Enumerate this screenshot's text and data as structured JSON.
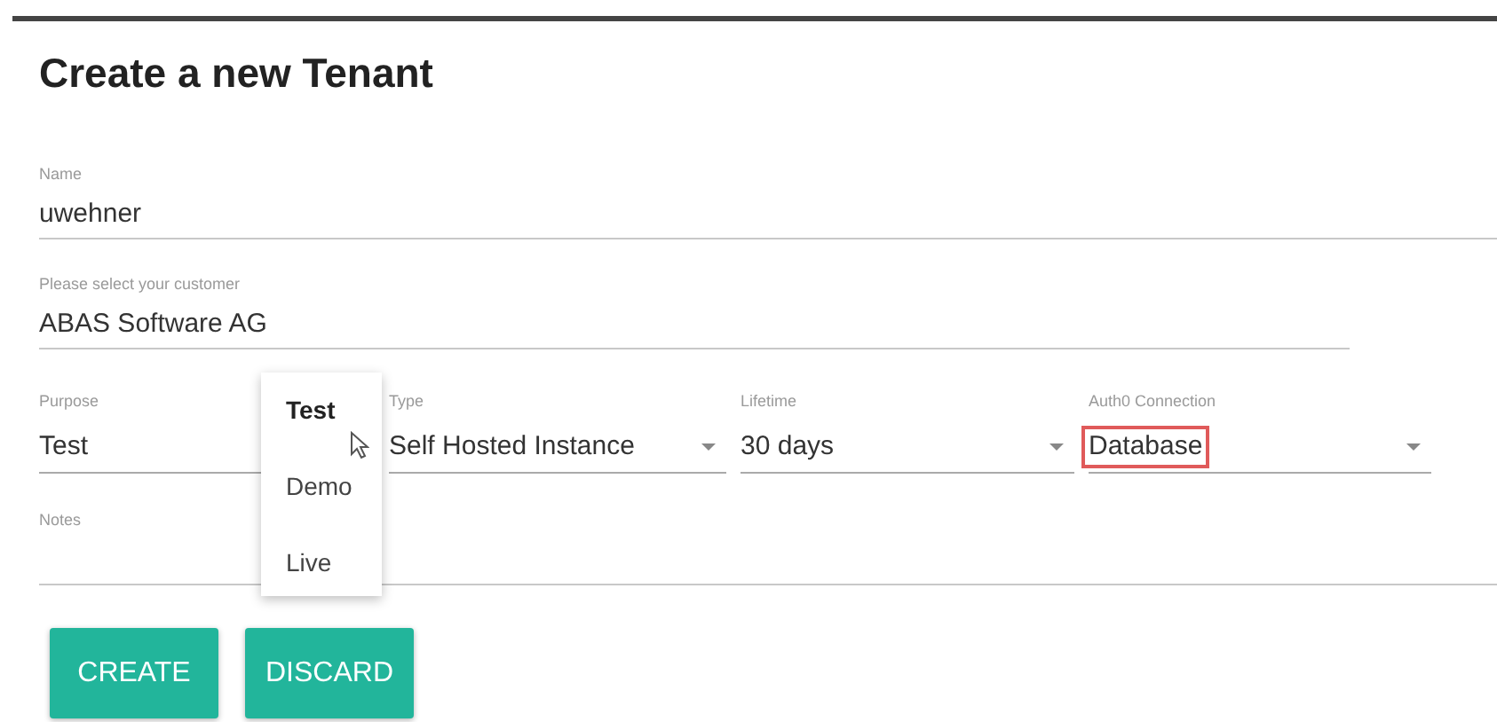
{
  "title": "Create a new Tenant",
  "fields": [
    {
      "label": "Name",
      "value": "uwehner"
    },
    {
      "label": "Please select your customer",
      "value": "ABAS Software AG"
    }
  ],
  "selects": [
    {
      "label": "Purpose",
      "value": "Test",
      "open": true,
      "highlighted": false
    },
    {
      "label": "Type",
      "value": "Self Hosted Instance",
      "open": false,
      "highlighted": false
    },
    {
      "label": "Lifetime",
      "value": "30 days",
      "open": false,
      "highlighted": false
    },
    {
      "label": "Auth0 Connection",
      "value": "Database",
      "open": false,
      "highlighted": true
    }
  ],
  "menu": [
    {
      "label": "Test",
      "selected": true
    },
    {
      "label": "Demo",
      "selected": false
    },
    {
      "label": "Live",
      "selected": false
    }
  ],
  "notes": {
    "label": "Notes"
  },
  "buttons": [
    "CREATE",
    "DISCARD"
  ]
}
